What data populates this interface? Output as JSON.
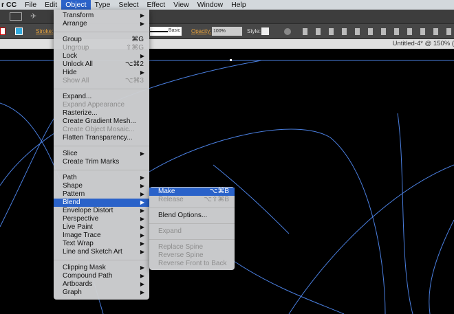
{
  "menubar": {
    "app": "r CC",
    "items": [
      "File",
      "Edit",
      "Object",
      "Type",
      "Select",
      "Effect",
      "View",
      "Window",
      "Help"
    ],
    "active": "Object"
  },
  "control": {
    "stroke_label": "Stroke:",
    "brush": "Basic",
    "opacity_label": "Opacity:",
    "opacity": "100%",
    "style_label": "Style:"
  },
  "document": {
    "title": "Untitled-4* @ 150% ("
  },
  "object_menu": {
    "groups": [
      [
        {
          "label": "Transform",
          "sub": true
        },
        {
          "label": "Arrange",
          "sub": true
        }
      ],
      [
        {
          "label": "Group",
          "shortcut": "⌘G"
        },
        {
          "label": "Ungroup",
          "shortcut": "⇧⌘G",
          "disabled": true
        },
        {
          "label": "Lock",
          "sub": true
        },
        {
          "label": "Unlock All",
          "shortcut": "⌥⌘2"
        },
        {
          "label": "Hide",
          "sub": true
        },
        {
          "label": "Show All",
          "shortcut": "⌥⌘3",
          "disabled": true
        }
      ],
      [
        {
          "label": "Expand..."
        },
        {
          "label": "Expand Appearance",
          "disabled": true
        },
        {
          "label": "Rasterize..."
        },
        {
          "label": "Create Gradient Mesh..."
        },
        {
          "label": "Create Object Mosaic...",
          "disabled": true
        },
        {
          "label": "Flatten Transparency..."
        }
      ],
      [
        {
          "label": "Slice",
          "sub": true
        },
        {
          "label": "Create Trim Marks"
        }
      ],
      [
        {
          "label": "Path",
          "sub": true
        },
        {
          "label": "Shape",
          "sub": true
        },
        {
          "label": "Pattern",
          "sub": true
        },
        {
          "label": "Blend",
          "sub": true,
          "highlighted": true
        },
        {
          "label": "Envelope Distort",
          "sub": true
        },
        {
          "label": "Perspective",
          "sub": true
        },
        {
          "label": "Live Paint",
          "sub": true
        },
        {
          "label": "Image Trace",
          "sub": true
        },
        {
          "label": "Text Wrap",
          "sub": true
        },
        {
          "label": "Line and Sketch Art",
          "sub": true
        }
      ],
      [
        {
          "label": "Clipping Mask",
          "sub": true
        },
        {
          "label": "Compound Path",
          "sub": true
        },
        {
          "label": "Artboards",
          "sub": true
        },
        {
          "label": "Graph",
          "sub": true
        }
      ]
    ]
  },
  "blend_menu": {
    "groups": [
      [
        {
          "label": "Make",
          "shortcut": "⌥⌘B",
          "highlighted": true
        },
        {
          "label": "Release",
          "shortcut": "⌥⇧⌘B",
          "disabled": true
        }
      ],
      [
        {
          "label": "Blend Options..."
        }
      ],
      [
        {
          "label": "Expand",
          "disabled": true
        }
      ],
      [
        {
          "label": "Replace Spine",
          "disabled": true
        },
        {
          "label": "Reverse Spine",
          "disabled": true
        },
        {
          "label": "Reverse Front to Back",
          "disabled": true
        }
      ]
    ]
  },
  "colors": {
    "highlight": "#2a62c9",
    "path": "#4a7fe0"
  }
}
